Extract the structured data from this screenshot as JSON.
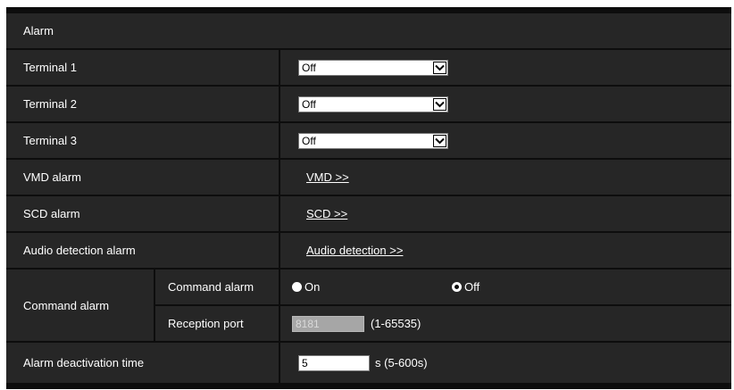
{
  "section": {
    "title": "Alarm"
  },
  "terminals": [
    {
      "label": "Terminal 1",
      "selected": "Off"
    },
    {
      "label": "Terminal 2",
      "selected": "Off"
    },
    {
      "label": "Terminal 3",
      "selected": "Off"
    }
  ],
  "vmd": {
    "label": "VMD alarm",
    "link": "VMD >>"
  },
  "scd": {
    "label": "SCD alarm",
    "link": "SCD >>"
  },
  "audio": {
    "label": "Audio detection alarm",
    "link": "Audio detection >>"
  },
  "command": {
    "group_label": "Command alarm",
    "alarm_label": "Command alarm",
    "on_label": "On",
    "off_label": "Off",
    "selected": "Off",
    "port_label": "Reception port",
    "port_value": "8181",
    "port_range": "(1-65535)"
  },
  "deactivation": {
    "label": "Alarm deactivation time",
    "value": "5",
    "unit": "s (5-600s)"
  },
  "icons": {
    "select_arrow": "chevron-down-icon",
    "radio_selected": "radio-selected-icon",
    "radio_unselected": "radio-unselected-icon"
  },
  "colors": {
    "background": "#0d0d0d",
    "row": "#262626",
    "text": "#ffffff"
  }
}
